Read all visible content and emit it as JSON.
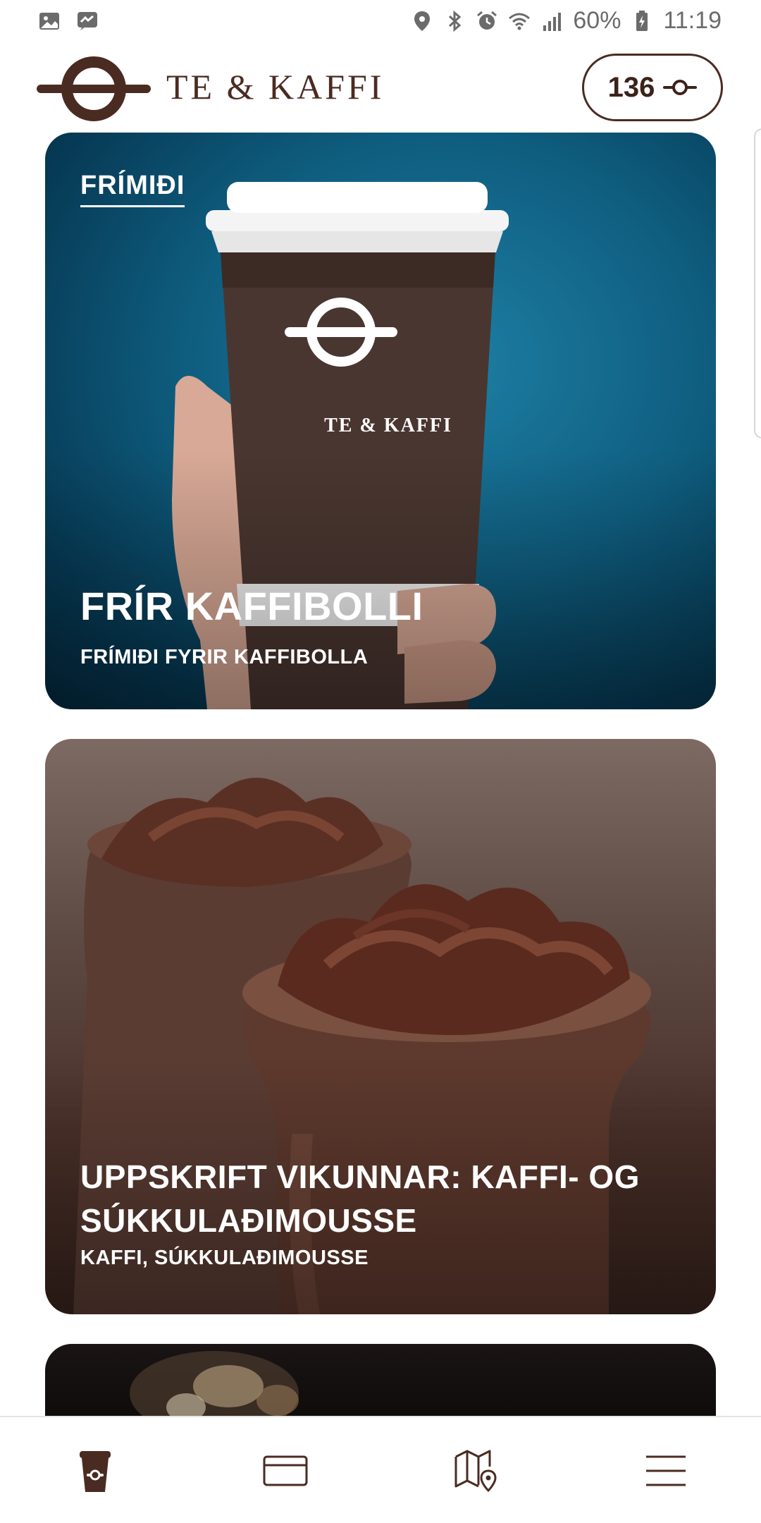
{
  "status_bar": {
    "battery": "60%",
    "time": "11:19",
    "left_icons": [
      "gallery-icon",
      "messenger-icon"
    ],
    "right_icons": [
      "location-icon",
      "bluetooth-icon",
      "alarm-icon",
      "wifi-icon",
      "signal-icon",
      "battery-charging-icon"
    ]
  },
  "header": {
    "brand": "TE & KAFFI",
    "points": "136",
    "logo_icon": "te-kaffi-logo",
    "points_icon": "bean-ring-icon"
  },
  "cards": [
    {
      "tag": "FRÍMIÐI",
      "title": "FRÍR KAFFIBOLLI",
      "subtitle": "FRÍMIÐI FYRIR KAFFIBOLLA",
      "cup_text": "TE & KAFFI"
    },
    {
      "title": "UPPSKRIFT VIKUNNAR: KAFFI- OG SÚKKULAÐIMOUSSE",
      "subtitle": "KAFFI, SÚKKULAÐIMOUSSE"
    },
    {}
  ],
  "bottom_nav": {
    "items": [
      "cup-icon",
      "card-icon",
      "map-icon",
      "menu-icon"
    ],
    "active": 0
  },
  "colors": {
    "brand_brown": "#4a2b22",
    "card1_blue": "#0f5e80",
    "card2_brown": "#4a3029"
  }
}
